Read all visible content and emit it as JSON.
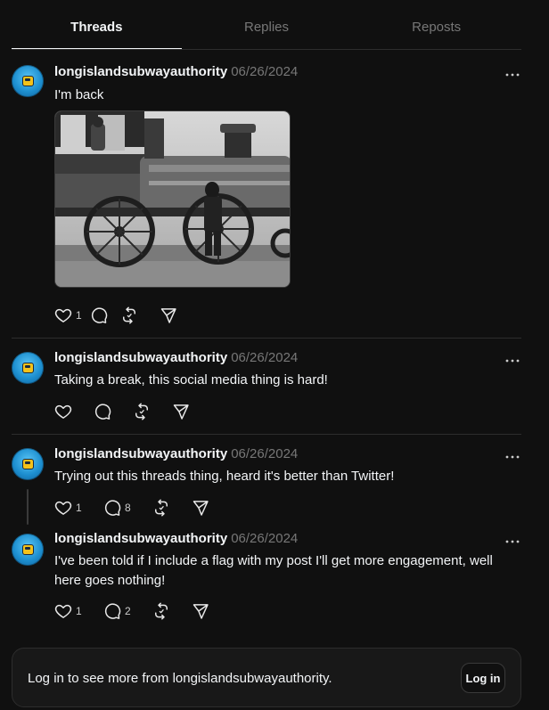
{
  "tabs": [
    {
      "label": "Threads",
      "active": true
    },
    {
      "label": "Replies",
      "active": false
    },
    {
      "label": "Reposts",
      "active": false
    }
  ],
  "posts": [
    {
      "username": "longislandsubwayauthority",
      "date": "06/26/2024",
      "text": "I'm back",
      "has_media": true,
      "media_description": "black-and-white photo of a steam locomotive",
      "likes": "1",
      "replies": "",
      "reposts": "",
      "shares": ""
    },
    {
      "username": "longislandsubwayauthority",
      "date": "06/26/2024",
      "text": "Taking a break, this social media thing is hard!",
      "has_media": false,
      "likes": "",
      "replies": "",
      "reposts": "",
      "shares": ""
    },
    {
      "username": "longislandsubwayauthority",
      "date": "06/26/2024",
      "text": "Trying out this threads thing, heard it's better than Twitter!",
      "has_media": false,
      "likes": "1",
      "replies": "8",
      "reposts": "",
      "shares": ""
    },
    {
      "username": "longislandsubwayauthority",
      "date": "06/26/2024",
      "text": "I've been told if I include a flag with my post I'll get more engagement, well here goes nothing!",
      "has_media": false,
      "likes": "1",
      "replies": "2",
      "reposts": "",
      "shares": ""
    }
  ],
  "icons": {
    "more": "more-horizontal-icon",
    "like": "heart-icon",
    "reply": "comment-icon",
    "repost": "repost-icon",
    "share": "send-icon"
  },
  "login_prompt": {
    "text": "Log in to see more from longislandsubwayauthority.",
    "button_label": "Log in"
  },
  "colors": {
    "background": "#101010",
    "text": "#f3f5f7",
    "muted": "#777777",
    "divider": "#2d2d2d",
    "card": "#181818",
    "avatar_blue": "#1d8fd0",
    "avatar_badge": "#f4c21a"
  }
}
